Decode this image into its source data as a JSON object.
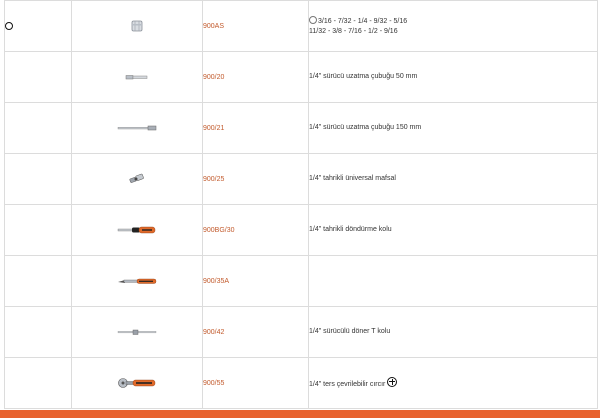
{
  "rows": [
    {
      "code": "900AS",
      "desc_line1": "3/16 - 7/32 - 1/4 - 9/32 - 5/16",
      "desc_line2": "11/32 - 3/8 - 7/16 - 1/2 - 9/16",
      "image_icon": "hex-socket-icon"
    },
    {
      "code": "900/20",
      "desc": "1/4\" sürücü uzatma çubuğu 50 mm",
      "image_icon": "extension-bar-short-icon"
    },
    {
      "code": "900/21",
      "desc": "1/4\" sürücü uzatma çubuğu 150 mm",
      "image_icon": "extension-bar-long-icon"
    },
    {
      "code": "900/25",
      "desc": "1/4\" tahrikli üniversal mafsal",
      "image_icon": "universal-joint-icon"
    },
    {
      "code": "900BG/30",
      "desc": "1/4\" tahrikli döndürme kolu",
      "image_icon": "spinner-handle-icon"
    },
    {
      "code": "900/35A",
      "desc": "",
      "image_icon": "ratchet-flat-icon"
    },
    {
      "code": "900/42",
      "desc": "1/4\" sürücülü döner T kolu",
      "image_icon": "sliding-t-bar-icon"
    },
    {
      "code": "900/55",
      "desc": "1/4\" ters çevrilebilir cırcır",
      "image_icon": "reversible-ratchet-icon"
    }
  ],
  "colors": {
    "code": "#c25a2c",
    "accent_bar": "#e8622e",
    "handle_orange": "#e06a2a",
    "border": "#dcdcdc"
  }
}
